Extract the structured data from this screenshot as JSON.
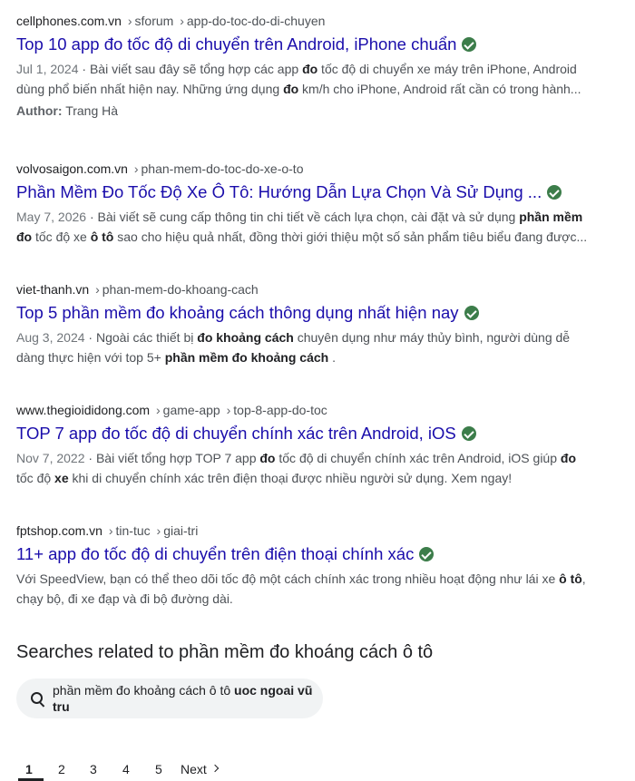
{
  "results": [
    {
      "domain": "cellphones.com.vn",
      "path": [
        "sforum",
        "app-do-toc-do-di-chuyen"
      ],
      "title": "Top 10 app đo tốc độ di chuyển trên Android, iPhone chuẩn",
      "date": "Jul 1, 2024",
      "snippet_lines": [
        [
          {
            "t": "Bài viết sau đây sẽ tổng hợp các app "
          },
          {
            "t": "đo",
            "b": true
          },
          {
            "t": " tốc độ di chuyển xe máy trên iPhone, Android"
          }
        ],
        [
          {
            "t": "dùng phổ biến nhất hiện nay. Những ứng dụng "
          },
          {
            "t": "đo",
            "b": true
          },
          {
            "t": " km/h cho iPhone, Android rất cần có trong hành..."
          }
        ]
      ],
      "author_label": "Author:",
      "author_name": "Trang Hà"
    },
    {
      "domain": "volvosaigon.com.vn",
      "path": [
        "phan-mem-do-toc-do-xe-o-to"
      ],
      "title": "Phần Mềm Đo Tốc Độ Xe Ô Tô: Hướng Dẫn Lựa Chọn Và Sử Dụng ...",
      "date": "May 7, 2026",
      "snippet_lines": [
        [
          {
            "t": "Bài viết sẽ cung cấp thông tin chi tiết về cách lựa chọn, cài đặt và sử dụng "
          },
          {
            "t": "phần mềm",
            "b": true
          }
        ],
        [
          {
            "t": "đo",
            "b": true
          },
          {
            "t": " tốc độ xe "
          },
          {
            "t": "ô tô",
            "b": true
          },
          {
            "t": " sao cho hiệu quả nhất, đồng thời giới thiệu một số sản phẩm tiêu biểu đang được..."
          }
        ]
      ]
    },
    {
      "domain": "viet-thanh.vn",
      "path": [
        "phan-mem-do-khoang-cach"
      ],
      "title": "Top 5 phần mềm đo khoảng cách thông dụng nhất hiện nay",
      "date": "Aug 3, 2024",
      "snippet_lines": [
        [
          {
            "t": "Ngoài các thiết bị "
          },
          {
            "t": "đo khoảng cách",
            "b": true
          },
          {
            "t": " chuyên dụng như máy thủy bình, người dùng dễ"
          }
        ],
        [
          {
            "t": "dàng thực hiện với top 5+ "
          },
          {
            "t": "phần mềm đo khoảng cách",
            "b": true
          },
          {
            "t": " ."
          }
        ]
      ]
    },
    {
      "domain": "www.thegioididong.com",
      "path": [
        "game-app",
        "top-8-app-do-toc"
      ],
      "title": "TOP 7 app đo tốc độ di chuyển chính xác trên Android, iOS",
      "date": "Nov 7, 2022",
      "snippet_lines": [
        [
          {
            "t": "Bài viết tổng hợp TOP 7 app "
          },
          {
            "t": "đo",
            "b": true
          },
          {
            "t": " tốc độ di chuyển chính xác trên Android, iOS giúp "
          },
          {
            "t": "đo",
            "b": true
          }
        ],
        [
          {
            "t": "tốc độ "
          },
          {
            "t": "xe",
            "b": true
          },
          {
            "t": " khi di chuyển chính xác trên điện thoại được nhiều người sử dụng. Xem ngay!"
          }
        ]
      ]
    },
    {
      "domain": "fptshop.com.vn",
      "path": [
        "tin-tuc",
        "giai-tri"
      ],
      "title": "11+ app đo tốc độ di chuyển trên điện thoại chính xác",
      "date": "",
      "snippet_lines": [
        [
          {
            "t": "Với SpeedView, bạn có thể theo dõi tốc độ một cách chính xác trong nhiều hoạt động như lái xe "
          },
          {
            "t": "ô tô",
            "b": true
          },
          {
            "t": ","
          }
        ],
        [
          {
            "t": "chạy bộ, đi xe đạp và đi bộ đường dài."
          }
        ]
      ]
    }
  ],
  "related": {
    "heading": "Searches related to phần mềm đo khoáng cách ô tô",
    "chips": [
      {
        "normal": "phần mềm đo khoảng cách ô tô ",
        "bold": "uoc ngoai vũ tru",
        "icon": "search-icon"
      }
    ]
  },
  "pagination": {
    "pages": [
      "1",
      "2",
      "3",
      "4",
      "5"
    ],
    "current": "1",
    "next_label": "Next"
  }
}
